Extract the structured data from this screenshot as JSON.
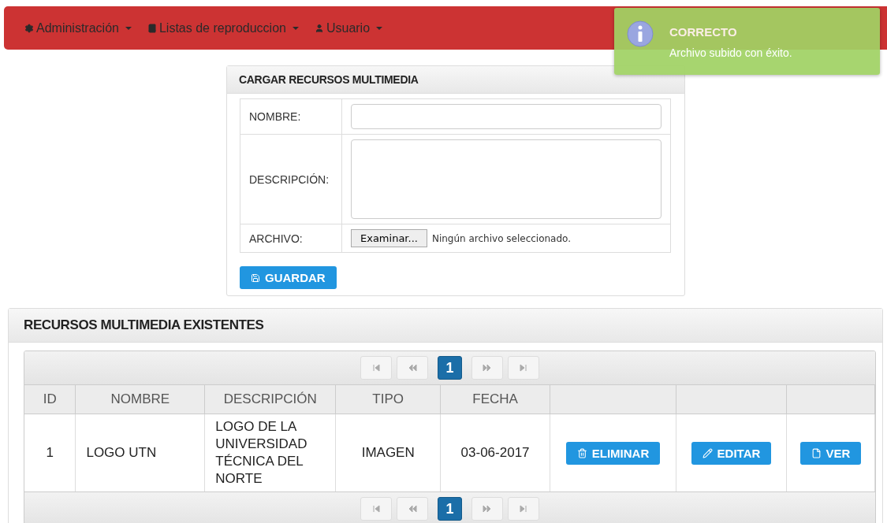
{
  "navbar": {
    "menus": [
      {
        "label": "Administración"
      },
      {
        "label": "Listas de reproduccion"
      },
      {
        "label": "Usuario"
      }
    ]
  },
  "toast": {
    "title": "CORRECTO",
    "message": "Archivo subido con éxito."
  },
  "upload_form": {
    "title": "CARGAR RECURSOS MULTIMEDIA",
    "fields": [
      {
        "label": "NOMBRE:",
        "kind": "text"
      },
      {
        "label": "DESCRIPCIÓN:",
        "kind": "textarea"
      },
      {
        "label": "ARCHIVO:",
        "kind": "file",
        "button": "Examinar...",
        "status": "Ningún archivo seleccionado."
      }
    ],
    "save": "GUARDAR"
  },
  "resources": {
    "title": "RECURSOS MULTIMEDIA EXISTENTES",
    "pagers": [
      {
        "pages": [
          {
            "label": "1",
            "selected": true
          }
        ]
      },
      {
        "pages": [
          {
            "label": "1",
            "selected": true
          }
        ]
      }
    ],
    "columns": [
      "ID",
      "NOMBRE",
      "DESCRIPCIÓN",
      "TIPO",
      "FECHA"
    ],
    "rows": [
      {
        "cells": [
          "1",
          "LOGO UTN",
          "LOGO DE LA UNIVERSIDAD TÉCNICA DEL NORTE",
          "IMAGEN",
          "03-06-2017"
        ],
        "actions": [
          {
            "label": "ELIMINAR",
            "kind": "delete"
          },
          {
            "label": "EDITAR",
            "kind": "edit"
          },
          {
            "label": "VER",
            "kind": "view"
          }
        ]
      }
    ]
  }
}
